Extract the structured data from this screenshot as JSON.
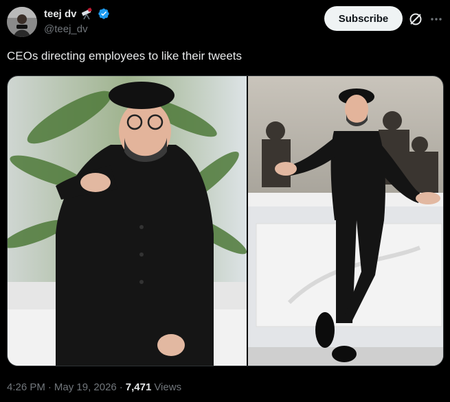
{
  "author": {
    "display_name": "teej dv",
    "handle": "@teej_dv",
    "emoji_icon": "telescope-icon",
    "verified_color": "#1d9bf0"
  },
  "actions": {
    "subscribe_label": "Subscribe"
  },
  "tweet": {
    "text": "CEOs directing employees to like their tweets"
  },
  "footer": {
    "time": "4:26 PM",
    "separator_1": "·",
    "date": "May 19, 2026",
    "separator_2": "·",
    "views_count": "7,471",
    "views_label": "Views"
  },
  "colors": {
    "background": "#000000",
    "text_primary": "#e7e9ea",
    "text_secondary": "#71767b",
    "accent": "#1d9bf0"
  }
}
